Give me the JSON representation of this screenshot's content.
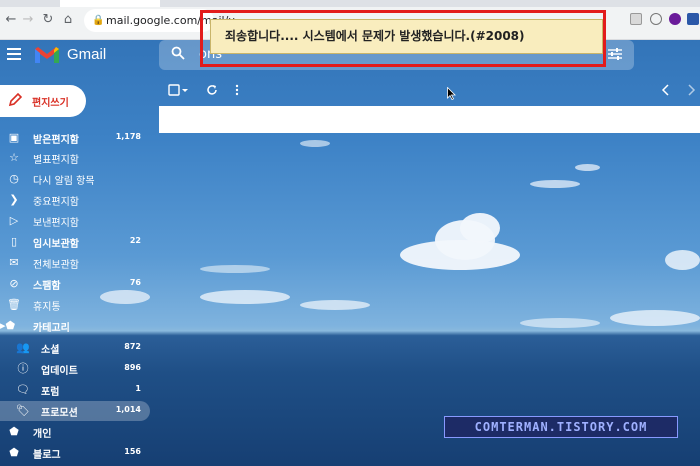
{
  "browser": {
    "url": "mail.google.com/mail/u"
  },
  "header": {
    "app_name": "Gmail",
    "search_value": "ons"
  },
  "compose": {
    "label": "편지쓰기"
  },
  "sidebar": {
    "items": [
      {
        "label": "받은편지함",
        "count": "1,178",
        "icon": "inbox-icon"
      },
      {
        "label": "별표편지함",
        "count": "",
        "icon": "star-icon"
      },
      {
        "label": "다시 알림 항목",
        "count": "",
        "icon": "clock-icon"
      },
      {
        "label": "중요편지함",
        "count": "",
        "icon": "important-icon"
      },
      {
        "label": "보낸편지함",
        "count": "",
        "icon": "send-icon"
      },
      {
        "label": "임시보관함",
        "count": "22",
        "icon": "draft-icon"
      },
      {
        "label": "전체보관함",
        "count": "",
        "icon": "mail-icon"
      },
      {
        "label": "스팸함",
        "count": "76",
        "icon": "spam-icon"
      },
      {
        "label": "휴지통",
        "count": "",
        "icon": "trash-icon"
      },
      {
        "label": "카테고리",
        "count": "",
        "icon": "label-icon"
      },
      {
        "label": "소셜",
        "count": "872",
        "icon": "people-icon"
      },
      {
        "label": "업데이트",
        "count": "896",
        "icon": "info-icon"
      },
      {
        "label": "포럼",
        "count": "1",
        "icon": "forum-icon"
      },
      {
        "label": "프로모션",
        "count": "1,014",
        "icon": "tag-icon"
      },
      {
        "label": "개인",
        "count": "",
        "icon": "label-icon"
      },
      {
        "label": "블로그",
        "count": "156",
        "icon": "label-icon"
      }
    ]
  },
  "error": {
    "message": "죄송합니다.... 시스템에서 문제가 발생했습니다.(#2008)"
  },
  "watermark": {
    "text": "COMTERMAN.TISTORY.COM"
  },
  "colors": {
    "error_border": "#e21b1b",
    "toast_bg": "#f9edbe",
    "compose_text": "#d93025"
  }
}
